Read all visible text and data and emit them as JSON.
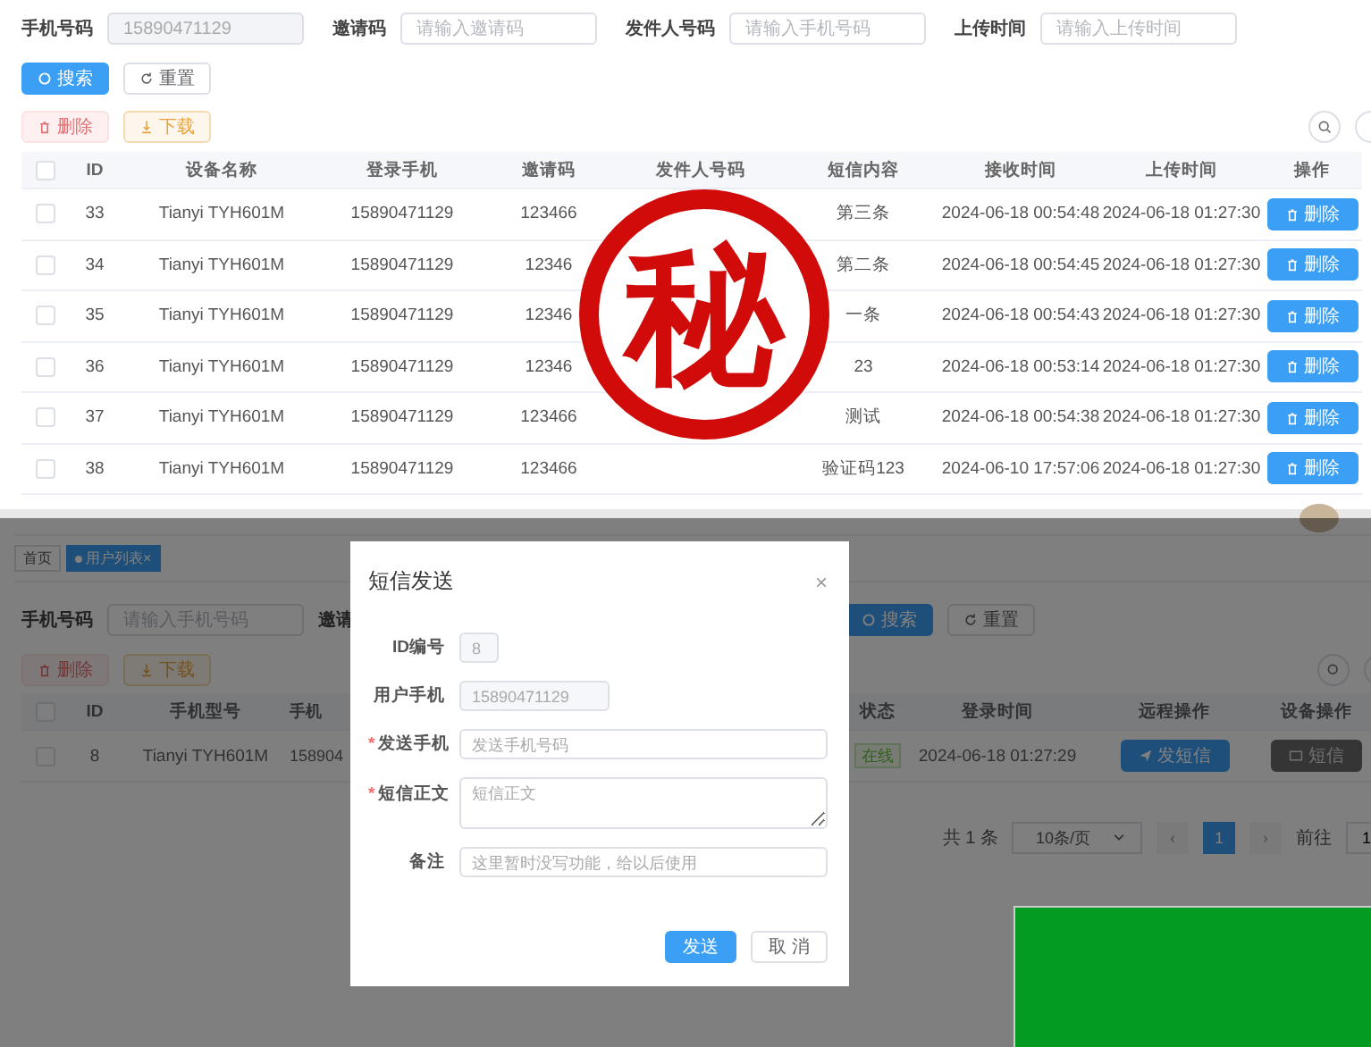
{
  "filters": [
    {
      "label": "手机号码",
      "value": "15890471129",
      "disabled": true
    },
    {
      "label": "邀请码",
      "placeholder": "请输入邀请码",
      "disabled": false
    },
    {
      "label": "发件人号码",
      "placeholder": "请输入手机号码",
      "disabled": false
    },
    {
      "label": "上传时间",
      "placeholder": "请输入上传时间",
      "disabled": false
    }
  ],
  "search_button": "搜索",
  "reset_button": "重置",
  "delete_button": {
    "label": "删除",
    "disabled": true
  },
  "download_button": "下载",
  "table": {
    "all_checked": false,
    "columns": [
      "ID",
      "设备名称",
      "登录手机",
      "邀请码",
      "发件人号码",
      "短信内容",
      "接收时间",
      "上传时间",
      "操作"
    ],
    "rows": [
      {
        "checked": false,
        "id": "33",
        "device": "Tianyi TYH601M",
        "phone": "15890471129",
        "invite_code": "123466",
        "content": "第三条",
        "received": "2024-06-18 00:54:48",
        "uploaded": "2024-06-18 01:27:30",
        "action": "删除"
      },
      {
        "checked": false,
        "id": "34",
        "device": "Tianyi TYH601M",
        "phone": "15890471129",
        "invite_code": "12346",
        "content": "第二条",
        "received": "2024-06-18 00:54:45",
        "uploaded": "2024-06-18 01:27:30",
        "action": "删除"
      },
      {
        "checked": false,
        "id": "35",
        "device": "Tianyi TYH601M",
        "phone": "15890471129",
        "invite_code": "12346",
        "content": "一条",
        "received": "2024-06-18 00:54:43",
        "uploaded": "2024-06-18 01:27:30",
        "action": "删除"
      },
      {
        "checked": false,
        "id": "36",
        "device": "Tianyi TYH601M",
        "phone": "15890471129",
        "invite_code": "12346",
        "content": "23",
        "received": "2024-06-18 00:53:14",
        "uploaded": "2024-06-18 01:27:30",
        "action": "删除"
      },
      {
        "checked": false,
        "id": "37",
        "device": "Tianyi TYH601M",
        "phone": "15890471129",
        "invite_code": "123466",
        "content": "测试",
        "received": "2024-06-18 00:54:38",
        "uploaded": "2024-06-18 01:27:30",
        "action": "删除"
      },
      {
        "checked": false,
        "id": "38",
        "device": "Tianyi TYH601M",
        "phone": "15890471129",
        "invite_code": "123466",
        "content": "验证码123",
        "received": "2024-06-10 17:57:06",
        "uploaded": "2024-06-18 01:27:30",
        "action": "删除"
      }
    ]
  },
  "stamp": {
    "text": "秘"
  },
  "background_page": {
    "tabs": [
      {
        "label": "首页",
        "selected": false
      },
      {
        "label": "用户列表",
        "selected": true,
        "close": "×"
      }
    ],
    "filters": [
      {
        "label": "手机号码",
        "placeholder": "请输入手机号码"
      },
      {
        "label": "邀请"
      }
    ],
    "search_button": "搜索",
    "reset_button": "重置",
    "delete_button": "删除",
    "download_button": "下载",
    "all_checked": false,
    "columns": [
      "ID",
      "手机型号",
      "手机",
      "状态",
      "登录时间",
      "远程操作",
      "设备操作"
    ],
    "row": {
      "checked": false,
      "id": "8",
      "model": "Tianyi TYH601M",
      "phone": "158904",
      "status": "在线",
      "login": "2024-06-18 01:27:29",
      "remote": "发短信",
      "device": "短信"
    },
    "pagination": {
      "total": "共 1 条",
      "page_size": "10条/页",
      "prev": "‹",
      "pages": [
        {
          "label": "1",
          "selected": true
        }
      ],
      "next": "›",
      "goto_label": "前往",
      "goto_value": "1"
    }
  },
  "dialog": {
    "title": "短信发送",
    "close": "×",
    "fields": [
      {
        "label": "ID编号",
        "value": "8",
        "kind": "readonly"
      },
      {
        "label": "用户手机",
        "value": "15890471129",
        "kind": "readonly"
      },
      {
        "label": "发送手机",
        "placeholder": "发送手机号码",
        "kind": "input",
        "required_mark": "*"
      },
      {
        "label": "短信正文",
        "placeholder": "短信正文",
        "kind": "textarea",
        "required_mark": "*"
      },
      {
        "label": "备注",
        "placeholder": "这里暂时没写功能，给以后使用",
        "kind": "input"
      }
    ],
    "buttons": [
      {
        "label": "发送",
        "primary": true
      },
      {
        "label": "取 消",
        "primary": false
      }
    ]
  }
}
